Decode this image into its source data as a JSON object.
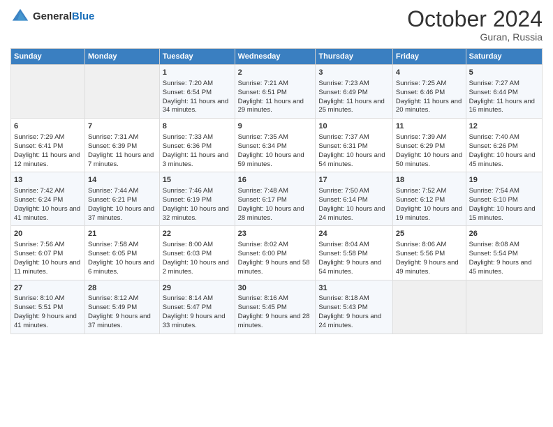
{
  "header": {
    "logo_general": "General",
    "logo_blue": "Blue",
    "title": "October 2024",
    "subtitle": "Guran, Russia"
  },
  "days_of_week": [
    "Sunday",
    "Monday",
    "Tuesday",
    "Wednesday",
    "Thursday",
    "Friday",
    "Saturday"
  ],
  "weeks": [
    [
      {
        "day": "",
        "content": ""
      },
      {
        "day": "",
        "content": ""
      },
      {
        "day": "1",
        "content": "Sunrise: 7:20 AM\nSunset: 6:54 PM\nDaylight: 11 hours and 34 minutes."
      },
      {
        "day": "2",
        "content": "Sunrise: 7:21 AM\nSunset: 6:51 PM\nDaylight: 11 hours and 29 minutes."
      },
      {
        "day": "3",
        "content": "Sunrise: 7:23 AM\nSunset: 6:49 PM\nDaylight: 11 hours and 25 minutes."
      },
      {
        "day": "4",
        "content": "Sunrise: 7:25 AM\nSunset: 6:46 PM\nDaylight: 11 hours and 20 minutes."
      },
      {
        "day": "5",
        "content": "Sunrise: 7:27 AM\nSunset: 6:44 PM\nDaylight: 11 hours and 16 minutes."
      }
    ],
    [
      {
        "day": "6",
        "content": "Sunrise: 7:29 AM\nSunset: 6:41 PM\nDaylight: 11 hours and 12 minutes."
      },
      {
        "day": "7",
        "content": "Sunrise: 7:31 AM\nSunset: 6:39 PM\nDaylight: 11 hours and 7 minutes."
      },
      {
        "day": "8",
        "content": "Sunrise: 7:33 AM\nSunset: 6:36 PM\nDaylight: 11 hours and 3 minutes."
      },
      {
        "day": "9",
        "content": "Sunrise: 7:35 AM\nSunset: 6:34 PM\nDaylight: 10 hours and 59 minutes."
      },
      {
        "day": "10",
        "content": "Sunrise: 7:37 AM\nSunset: 6:31 PM\nDaylight: 10 hours and 54 minutes."
      },
      {
        "day": "11",
        "content": "Sunrise: 7:39 AM\nSunset: 6:29 PM\nDaylight: 10 hours and 50 minutes."
      },
      {
        "day": "12",
        "content": "Sunrise: 7:40 AM\nSunset: 6:26 PM\nDaylight: 10 hours and 45 minutes."
      }
    ],
    [
      {
        "day": "13",
        "content": "Sunrise: 7:42 AM\nSunset: 6:24 PM\nDaylight: 10 hours and 41 minutes."
      },
      {
        "day": "14",
        "content": "Sunrise: 7:44 AM\nSunset: 6:21 PM\nDaylight: 10 hours and 37 minutes."
      },
      {
        "day": "15",
        "content": "Sunrise: 7:46 AM\nSunset: 6:19 PM\nDaylight: 10 hours and 32 minutes."
      },
      {
        "day": "16",
        "content": "Sunrise: 7:48 AM\nSunset: 6:17 PM\nDaylight: 10 hours and 28 minutes."
      },
      {
        "day": "17",
        "content": "Sunrise: 7:50 AM\nSunset: 6:14 PM\nDaylight: 10 hours and 24 minutes."
      },
      {
        "day": "18",
        "content": "Sunrise: 7:52 AM\nSunset: 6:12 PM\nDaylight: 10 hours and 19 minutes."
      },
      {
        "day": "19",
        "content": "Sunrise: 7:54 AM\nSunset: 6:10 PM\nDaylight: 10 hours and 15 minutes."
      }
    ],
    [
      {
        "day": "20",
        "content": "Sunrise: 7:56 AM\nSunset: 6:07 PM\nDaylight: 10 hours and 11 minutes."
      },
      {
        "day": "21",
        "content": "Sunrise: 7:58 AM\nSunset: 6:05 PM\nDaylight: 10 hours and 6 minutes."
      },
      {
        "day": "22",
        "content": "Sunrise: 8:00 AM\nSunset: 6:03 PM\nDaylight: 10 hours and 2 minutes."
      },
      {
        "day": "23",
        "content": "Sunrise: 8:02 AM\nSunset: 6:00 PM\nDaylight: 9 hours and 58 minutes."
      },
      {
        "day": "24",
        "content": "Sunrise: 8:04 AM\nSunset: 5:58 PM\nDaylight: 9 hours and 54 minutes."
      },
      {
        "day": "25",
        "content": "Sunrise: 8:06 AM\nSunset: 5:56 PM\nDaylight: 9 hours and 49 minutes."
      },
      {
        "day": "26",
        "content": "Sunrise: 8:08 AM\nSunset: 5:54 PM\nDaylight: 9 hours and 45 minutes."
      }
    ],
    [
      {
        "day": "27",
        "content": "Sunrise: 8:10 AM\nSunset: 5:51 PM\nDaylight: 9 hours and 41 minutes."
      },
      {
        "day": "28",
        "content": "Sunrise: 8:12 AM\nSunset: 5:49 PM\nDaylight: 9 hours and 37 minutes."
      },
      {
        "day": "29",
        "content": "Sunrise: 8:14 AM\nSunset: 5:47 PM\nDaylight: 9 hours and 33 minutes."
      },
      {
        "day": "30",
        "content": "Sunrise: 8:16 AM\nSunset: 5:45 PM\nDaylight: 9 hours and 28 minutes."
      },
      {
        "day": "31",
        "content": "Sunrise: 8:18 AM\nSunset: 5:43 PM\nDaylight: 9 hours and 24 minutes."
      },
      {
        "day": "",
        "content": ""
      },
      {
        "day": "",
        "content": ""
      }
    ]
  ]
}
